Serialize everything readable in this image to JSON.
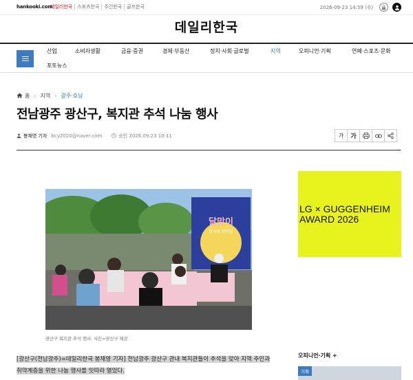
{
  "topbar": {
    "logo_text": "hankooki.com",
    "sites": [
      "데일리한국",
      "스포츠한국",
      "주간한국",
      "골프한국"
    ],
    "datetime": "2026-09-23 14:59 (수)"
  },
  "masthead": {
    "brand": "데일리한국"
  },
  "nav": {
    "items": [
      "산업",
      "소비자생활",
      "금융·증권",
      "경제·부동산",
      "정치·사회·글로벌",
      "지역",
      "오피니언·기획",
      "연예·스포츠·문화",
      "포토뉴스"
    ],
    "active_index": 5
  },
  "breadcrumb": {
    "home": "홈",
    "section": "지역",
    "subsection": "광주·호남"
  },
  "article": {
    "title": "전남광주 광산구, 복지관 추석 나눔 행사",
    "reporter": "봉채영 기자",
    "email": "bcy2020@naver.com",
    "date": "승인 2026.09.23 10:11",
    "photo_caption": "광산구 복지관 추석 행사. 사진=광산구 제공",
    "lede_line1": "[광산구(전남광주)=데일리한국 봉채영 기자] 전남광주 광산구 관내 복지관들이 추석을 맞아 지역 주민과",
    "lede_line2": "취약계층을 위한 나눔 행사를 잇따라 열었다.",
    "banner_line1": "달맞이",
    "banner_line2": "한가위 한마당"
  },
  "tools": [
    "가",
    "가",
    "print-icon",
    "link-icon",
    "share-icon"
  ],
  "ad": {
    "line1": "LG × GUGGENHEIM",
    "line2": "AWARD 2026",
    "bg": "#e8f21d"
  },
  "opinion": {
    "heading": "오피니언·기획",
    "tag": "기획"
  },
  "colors": {
    "accent": "#3c7bbf",
    "brand_red": "#d71920"
  }
}
